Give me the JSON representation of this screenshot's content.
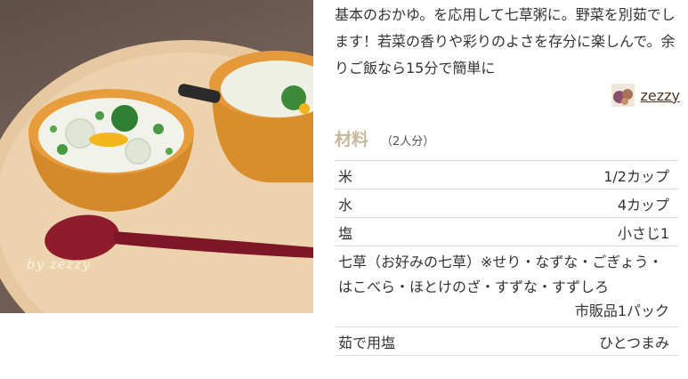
{
  "description": "基本のおかゆ。を応用して七草粥に。野菜を別茹でします！若菜の香りや彩りのよさを存分に楽しんで。余りご飯なら15分で簡単に",
  "author": {
    "name": "zezzy"
  },
  "photo": {
    "watermark": "by zezzy"
  },
  "ingredients": {
    "title": "材料",
    "serving": "（2人分）",
    "items": [
      {
        "name": "米",
        "qty": "1/2カップ"
      },
      {
        "name": "水",
        "qty": "4カップ"
      },
      {
        "name": "塩",
        "qty": "小さじ1"
      },
      {
        "name": "七草（お好みの七草）※せり・なずな・ごぎょう・はこべら・ほとけのざ・すずな・すずしろ",
        "qty": "市販品1パック"
      },
      {
        "name": "茹で用塩",
        "qty": "ひとつまみ"
      }
    ]
  },
  "colors": {
    "accent": "#c8b79a",
    "author": "#4d3522"
  }
}
